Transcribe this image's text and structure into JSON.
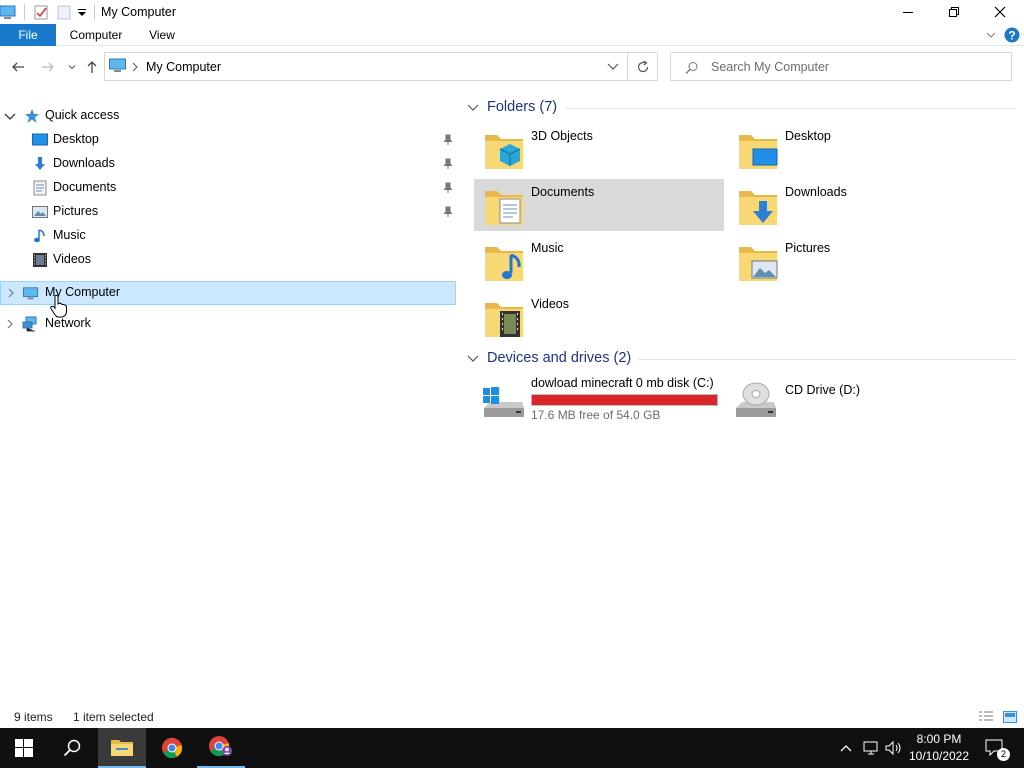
{
  "window": {
    "title": "My Computer"
  },
  "ribbon": {
    "tabs": [
      {
        "label": "File"
      },
      {
        "label": "Computer"
      },
      {
        "label": "View"
      }
    ]
  },
  "address": {
    "path": "My Computer"
  },
  "search": {
    "placeholder": "Search My Computer"
  },
  "sidebar": {
    "quick_access": {
      "label": "Quick access",
      "items": [
        {
          "label": "Desktop",
          "icon": "desktop-icon",
          "pinned": true
        },
        {
          "label": "Downloads",
          "icon": "downloads-icon",
          "pinned": true
        },
        {
          "label": "Documents",
          "icon": "documents-icon",
          "pinned": true
        },
        {
          "label": "Pictures",
          "icon": "pictures-icon",
          "pinned": true
        },
        {
          "label": "Music",
          "icon": "music-icon",
          "pinned": false
        },
        {
          "label": "Videos",
          "icon": "videos-icon",
          "pinned": false
        }
      ]
    },
    "my_computer": {
      "label": "My Computer",
      "selected": true
    },
    "network": {
      "label": "Network"
    }
  },
  "content": {
    "folders_header": "Folders (7)",
    "folders": [
      {
        "name": "3D Objects",
        "overlay": "cube"
      },
      {
        "name": "Desktop",
        "overlay": "monitor"
      },
      {
        "name": "Documents",
        "overlay": "doc",
        "highlighted": true
      },
      {
        "name": "Downloads",
        "overlay": "arrow"
      },
      {
        "name": "Music",
        "overlay": "note"
      },
      {
        "name": "Pictures",
        "overlay": "picture"
      },
      {
        "name": "Videos",
        "overlay": "film"
      }
    ],
    "drives_header": "Devices and drives (2)",
    "drives": [
      {
        "name": "dowload minecraft 0 mb disk (C:)",
        "free_text": "17.6 MB free of 54.0 GB",
        "used_fraction": 0.9997,
        "bar_color": "#da2626"
      },
      {
        "name": "CD Drive (D:)"
      }
    ]
  },
  "status": {
    "items_count": "9 items",
    "selected_count": "1 item selected"
  },
  "taskbar": {
    "time": "8:00 PM",
    "date": "10/10/2022",
    "notification_count": "2"
  },
  "colors": {
    "accent": "#1979ca",
    "selection": "#cce8ff",
    "header_text": "#1e3287",
    "taskbar": "#101010"
  }
}
